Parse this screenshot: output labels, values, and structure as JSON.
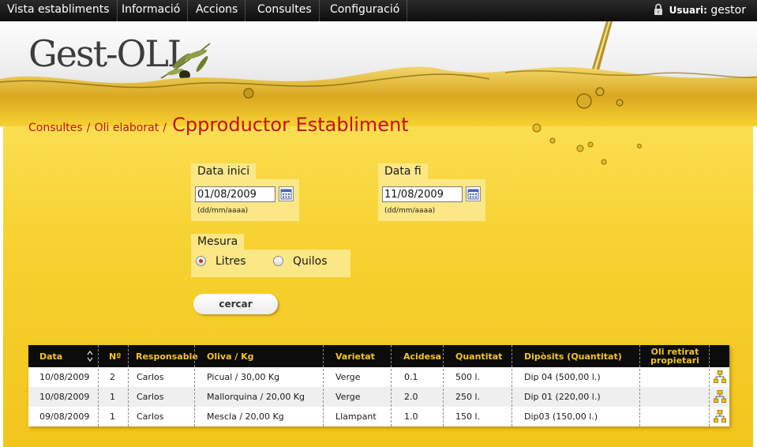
{
  "menu": {
    "items": [
      "Vista establiments",
      "Informació",
      "Accions",
      "Consultes",
      "Configuració"
    ],
    "user_label": "Usuari:",
    "user_name": "gestor"
  },
  "header": {
    "logo_text": "Gest-OLI"
  },
  "breadcrumb": {
    "crumb1": "Consultes",
    "crumb2": "Oli elaborat",
    "separator": "/",
    "title": "Cpproductor Establiment"
  },
  "filters": {
    "date_start": {
      "label": "Data inici",
      "value": "01/08/2009",
      "hint": "(dd/mm/aaaa)"
    },
    "date_end": {
      "label": "Data fi",
      "value": "11/08/2009",
      "hint": "(dd/mm/aaaa)"
    },
    "measure": {
      "label": "Mesura",
      "options": [
        "Litres",
        "Quilos"
      ],
      "selected": "Litres"
    },
    "search_label": "cercar"
  },
  "table": {
    "columns": [
      "Data",
      "Nº",
      "Responsable",
      "Oliva / Kg",
      "Varietat",
      "Acidesa",
      "Quantitat",
      "Dipòsits (Quantitat)",
      "Oli retirat propietari",
      ""
    ],
    "rows": [
      [
        "10/08/2009",
        "2",
        "Carlos",
        "Picual / 30,00 Kg",
        "Verge",
        "0.1",
        "500 l.",
        "Dip 04 (500,00 l.)",
        ""
      ],
      [
        "10/08/2009",
        "1",
        "Carlos",
        "Mallorquina / 20,00 Kg",
        "Verge",
        "2.0",
        "250 l.",
        "Dip 01 (220,00 l.)",
        ""
      ],
      [
        "09/08/2009",
        "1",
        "Carlos",
        "Mescla / 20,00 Kg",
        "Llampant",
        "1.0",
        "150 l.",
        "Dip03 (150,00 l.)",
        ""
      ]
    ]
  },
  "colors": {
    "topbar": "#111111",
    "panel": "#f7d232",
    "breadcrumb": "#c4121a",
    "table_header_text": "#f3c322"
  }
}
